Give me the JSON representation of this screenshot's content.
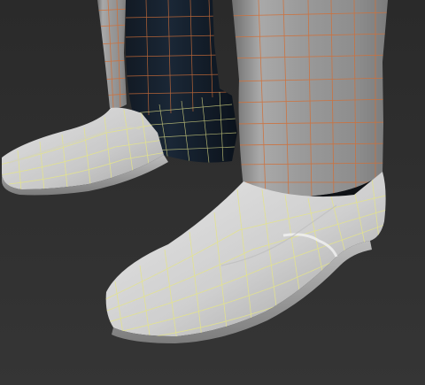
{
  "viewport": {
    "background": "#2e2e2e",
    "colors": {
      "trouser_gray": "#9a9a9a",
      "trouser_dark": "#0f1722",
      "shoe_white": "#d6d6d6",
      "wire_orange": "#d0703a",
      "wire_yellow": "#e4e48a"
    }
  }
}
